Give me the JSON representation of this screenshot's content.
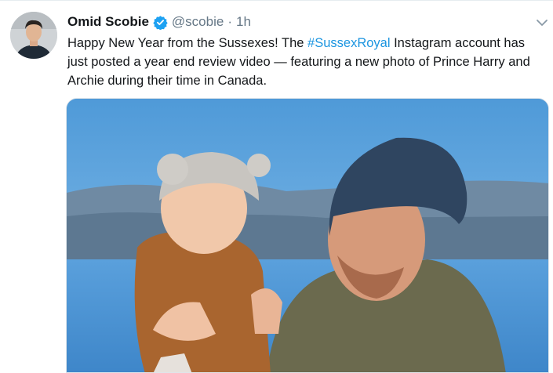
{
  "tweet": {
    "author": {
      "display_name": "Omid Scobie",
      "handle": "@scobie",
      "verified": true,
      "avatar_icon": "profile-photo"
    },
    "separator": "·",
    "time": "1h",
    "text_before": "Happy New Year from the Sussexes! The ",
    "hashtag": "#SussexRoyal",
    "text_after": " Instagram account has just posted a year end review video — featuring a new photo of Prince Harry and Archie during their time in Canada.",
    "more_icon": "chevron-down-icon",
    "media": {
      "type": "photo"
    }
  },
  "colors": {
    "text": "#14171a",
    "secondary": "#657786",
    "link": "#1b95e0",
    "verified": "#1da1f2"
  }
}
